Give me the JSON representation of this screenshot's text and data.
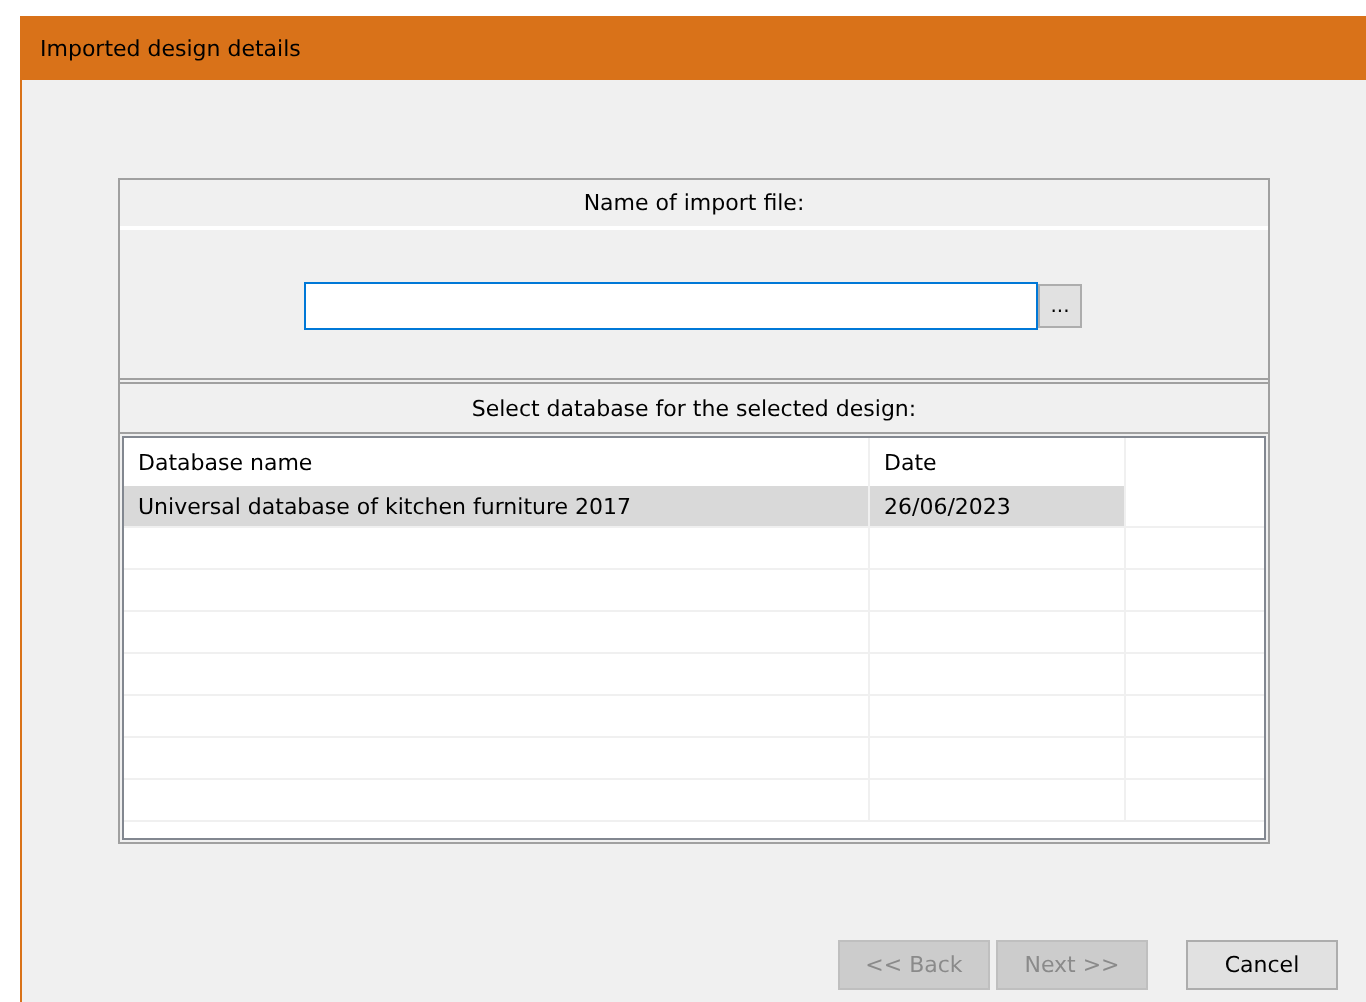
{
  "window": {
    "title": "Imported design details"
  },
  "import_file": {
    "label": "Name of import file:",
    "browse_button": "..."
  },
  "database": {
    "label": "Select database for the selected design:",
    "columns": [
      "Database name",
      "Date"
    ],
    "rows": [
      {
        "name": "Universal database of kitchen furniture 2017",
        "date": "26/06/2023",
        "selected": true
      }
    ]
  },
  "buttons": [
    {
      "label": "<< Back",
      "disabled": true
    },
    {
      "label": "Next >>",
      "disabled": true
    },
    {
      "label": "Cancel",
      "disabled": false
    }
  ]
}
